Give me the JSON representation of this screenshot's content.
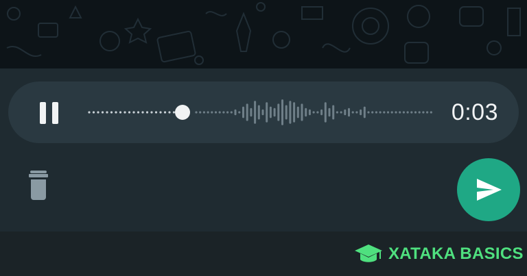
{
  "recorder": {
    "duration": "0:03",
    "playhead_fraction": 0.29,
    "pause_icon": "pause-icon",
    "delete_icon": "trash-icon",
    "send_icon": "send-icon"
  },
  "colors": {
    "accent": "#1fa885",
    "pill": "#2a3941",
    "panel": "#1f2b31",
    "brand": "#4fe07f"
  },
  "brand": {
    "text": "XATAKA BASICS",
    "logo_icon": "graduation-cap-icon"
  }
}
